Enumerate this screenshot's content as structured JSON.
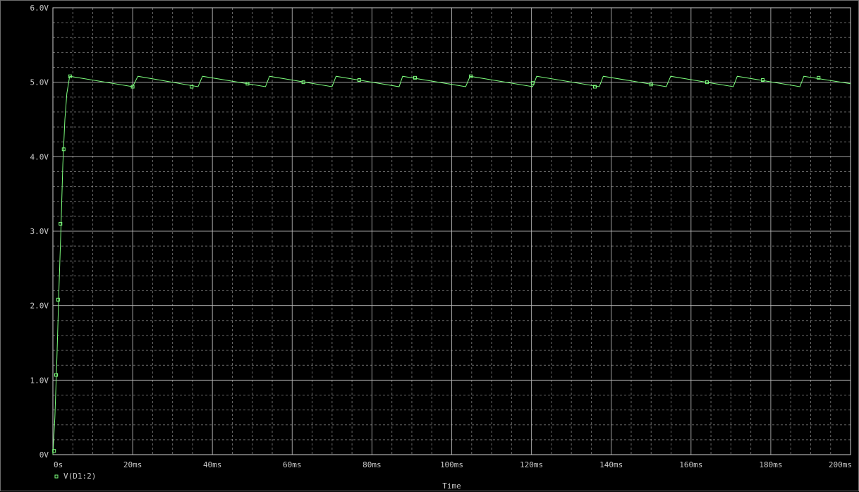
{
  "chart_data": {
    "type": "line",
    "title": "",
    "xlabel": "Time",
    "ylabel": "",
    "xlim": [
      0,
      200
    ],
    "ylim": [
      0,
      6
    ],
    "x_unit": "ms",
    "x_ticks": [
      0,
      20,
      40,
      60,
      80,
      100,
      120,
      140,
      160,
      180,
      200
    ],
    "x_tick_labels": [
      "0s",
      "20ms",
      "40ms",
      "60ms",
      "80ms",
      "100ms",
      "120ms",
      "140ms",
      "160ms",
      "180ms",
      "200ms"
    ],
    "y_ticks": [
      0,
      1,
      2,
      3,
      4,
      5,
      6
    ],
    "y_tick_labels": [
      "0V",
      "1.0V",
      "2.0V",
      "3.0V",
      "4.0V",
      "5.0V",
      "6.0V"
    ],
    "grid": true,
    "grid_minor_dashed": true,
    "background_color": "#000000",
    "grid_color": "#bdbdbd",
    "legend_position": "bottom-left",
    "series": [
      {
        "name": "V(D1:2)",
        "color": "#7dff7d",
        "marker": "square",
        "points": [
          [
            0,
            0.0
          ],
          [
            0.5,
            0.5
          ],
          [
            1.0,
            1.3
          ],
          [
            1.5,
            2.2
          ],
          [
            2.0,
            3.0
          ],
          [
            2.5,
            3.9
          ],
          [
            3.0,
            4.5
          ],
          [
            3.5,
            4.85
          ],
          [
            4.2,
            5.08
          ],
          [
            20.0,
            4.94
          ],
          [
            21.3,
            5.08
          ],
          [
            36.4,
            4.94
          ],
          [
            37.5,
            5.08
          ],
          [
            53.3,
            4.94
          ],
          [
            54.3,
            5.08
          ],
          [
            70.0,
            4.94
          ],
          [
            71.0,
            5.08
          ],
          [
            86.8,
            4.94
          ],
          [
            87.7,
            5.08
          ],
          [
            103.5,
            4.94
          ],
          [
            104.6,
            5.08
          ],
          [
            120.3,
            4.94
          ],
          [
            121.3,
            5.08
          ],
          [
            137.0,
            4.94
          ],
          [
            138.0,
            5.08
          ],
          [
            153.8,
            4.94
          ],
          [
            154.9,
            5.08
          ],
          [
            170.6,
            4.94
          ],
          [
            171.6,
            5.08
          ],
          [
            187.3,
            4.94
          ],
          [
            188.3,
            5.08
          ],
          [
            200.0,
            4.98
          ]
        ],
        "marker_points": [
          [
            0.3,
            0.05
          ],
          [
            0.8,
            1.07
          ],
          [
            1.3,
            2.08
          ],
          [
            1.9,
            3.1
          ],
          [
            2.7,
            4.1
          ],
          [
            4.3,
            5.08
          ],
          [
            20.0,
            4.94
          ],
          [
            34.8,
            4.94
          ],
          [
            48.8,
            4.98
          ],
          [
            62.8,
            5.0
          ],
          [
            76.8,
            5.03
          ],
          [
            90.8,
            5.06
          ],
          [
            104.8,
            5.08
          ],
          [
            120.3,
            4.99
          ],
          [
            135.9,
            4.94
          ],
          [
            150.0,
            4.97
          ],
          [
            164.0,
            5.0
          ],
          [
            178.0,
            5.03
          ],
          [
            192.0,
            5.06
          ]
        ]
      }
    ]
  }
}
